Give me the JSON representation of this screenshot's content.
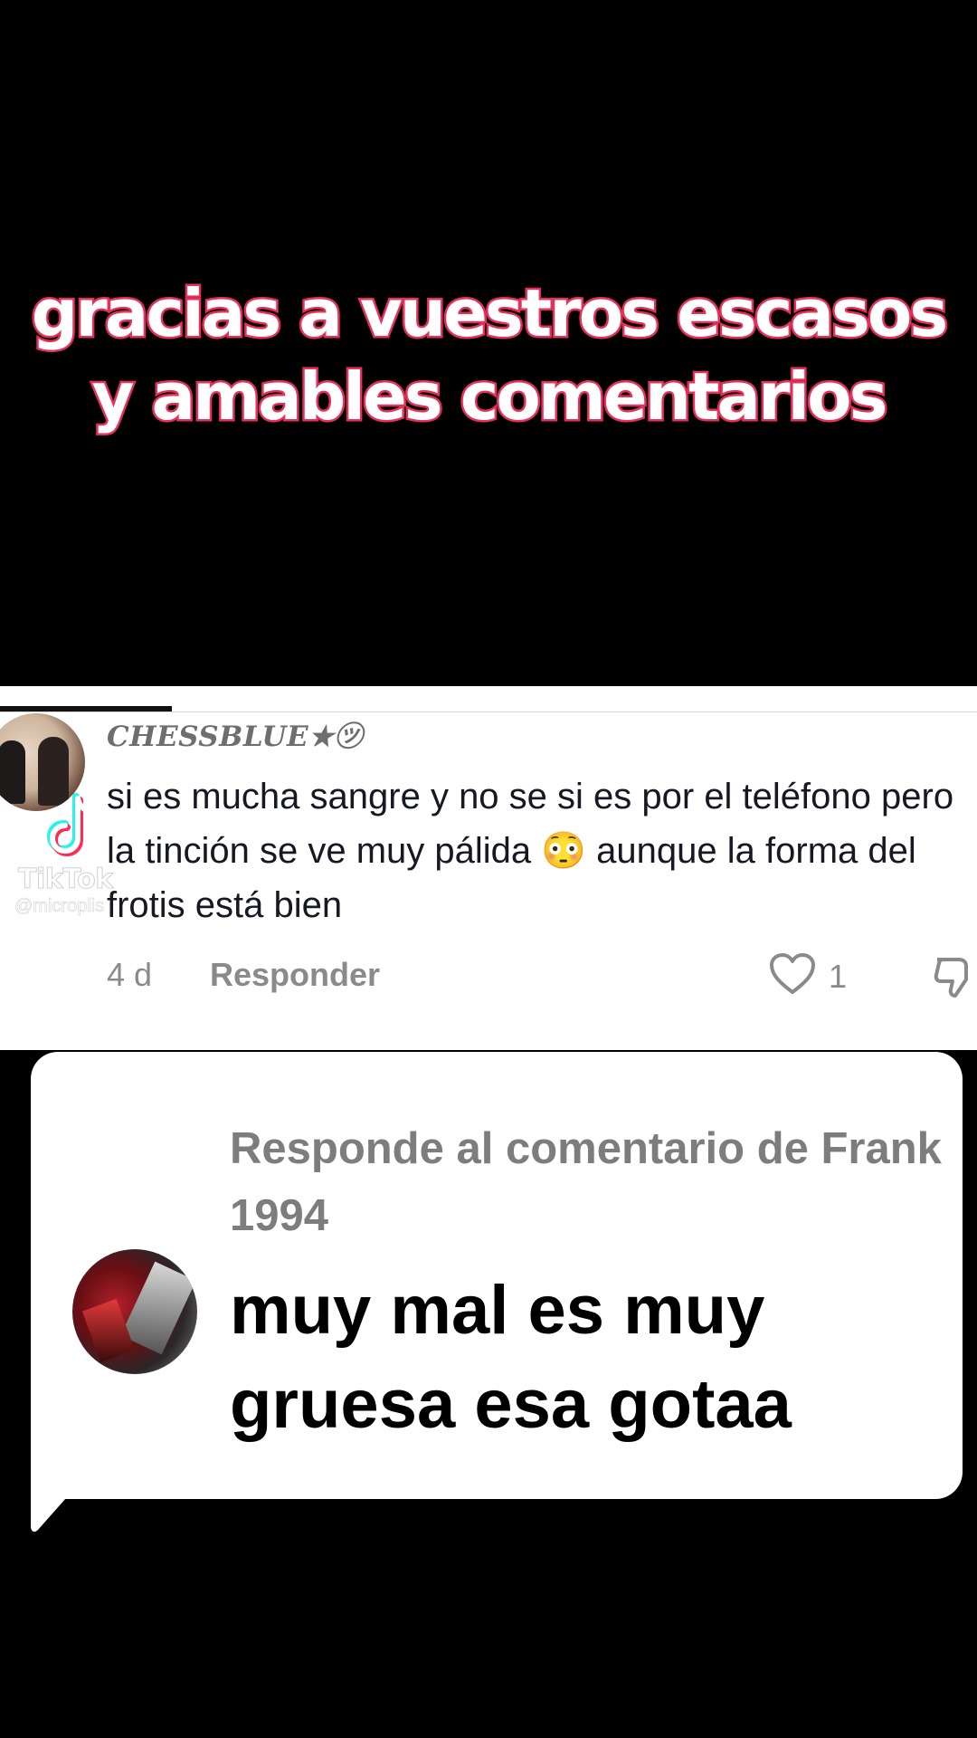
{
  "caption": {
    "line1": "gracias a vuestros escasos",
    "line2": "y amables comentarios",
    "stroke_color": "#e8305a"
  },
  "comment": {
    "username": "CHESSBLUE★㋡",
    "text": "si es mucha sangre y no se si es por el teléfono pero la tinción se ve muy pálida 😳 aunque la forma del frotis está bien",
    "time": "4 d",
    "reply_label": "Responder",
    "like_count": "1",
    "icons": {
      "avatar": "user-avatar",
      "like": "heart-outline-icon",
      "dislike": "thumbs-down-icon"
    }
  },
  "watermark": {
    "brand": "TikTok",
    "handle": "@microplis"
  },
  "reply": {
    "header": "Responde al comentario de Frank 1994",
    "text": "muy mal es muy gruesa esa gotaa",
    "icons": {
      "avatar": "user-avatar"
    }
  }
}
